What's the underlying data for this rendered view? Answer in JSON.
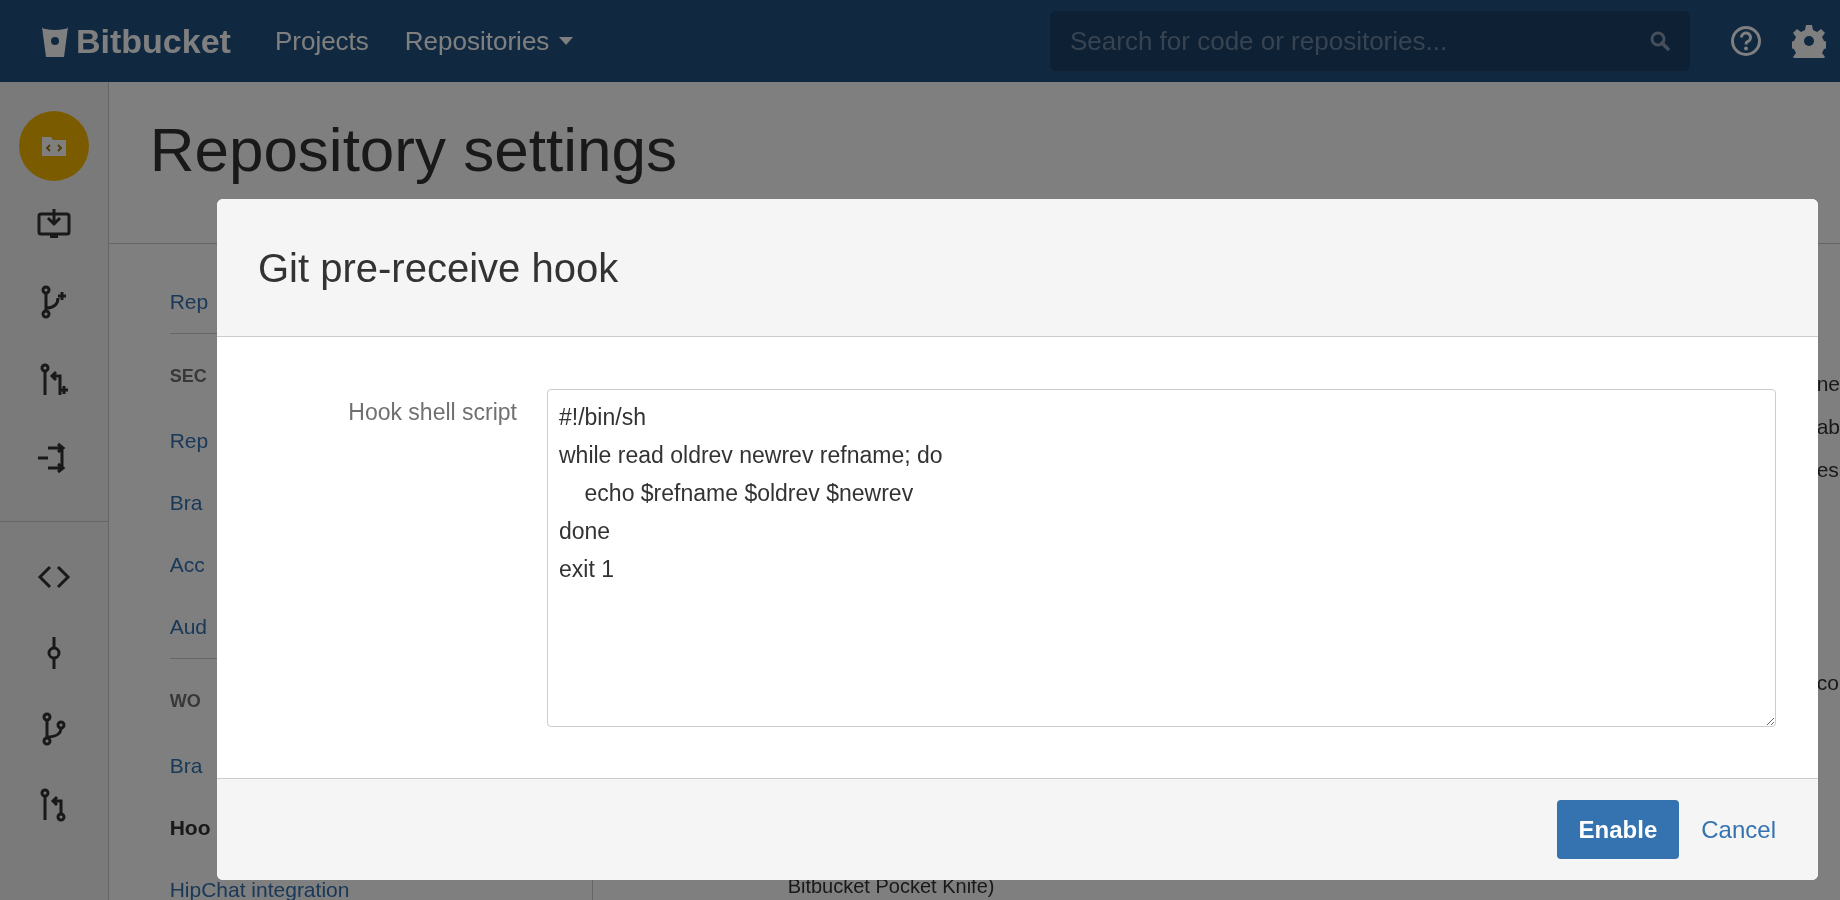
{
  "header": {
    "logo": "Bitbucket",
    "nav": [
      {
        "label": "Projects",
        "dropdown": false
      },
      {
        "label": "Repositories",
        "dropdown": true
      }
    ],
    "search": {
      "placeholder": "Search for code or repositories..."
    }
  },
  "rail": {
    "groups": [
      [
        {
          "kind": "repo",
          "selected": true
        },
        {
          "kind": "clone",
          "selected": false
        },
        {
          "kind": "branch-add",
          "selected": false
        },
        {
          "kind": "pr-add",
          "selected": false
        },
        {
          "kind": "fork",
          "selected": false
        }
      ],
      [
        {
          "kind": "source",
          "selected": false
        },
        {
          "kind": "commit",
          "selected": false
        },
        {
          "kind": "branches",
          "selected": false
        },
        {
          "kind": "pulls",
          "selected": false
        }
      ]
    ]
  },
  "page": {
    "title": "Repository settings",
    "nav_groups": [
      {
        "items": [
          {
            "label": "Rep",
            "selected": false
          }
        ]
      },
      {
        "heading": "SEC",
        "items": [
          {
            "label": "Rep",
            "selected": false
          },
          {
            "label": "Bra",
            "selected": false
          },
          {
            "label": "Acc",
            "selected": false
          },
          {
            "label": "Aud",
            "selected": false
          }
        ]
      },
      {
        "heading": "WO",
        "items": [
          {
            "label": "Bra",
            "selected": false
          },
          {
            "label": "Hoo",
            "selected": true
          },
          {
            "label": "HipChat integration",
            "selected": false
          }
        ]
      }
    ],
    "right_fragments": [
      "ne",
      "ab",
      "es",
      "co"
    ],
    "bottom_fragment": "Bitbucket Pocket Knife)"
  },
  "dialog": {
    "title": "Git pre-receive hook",
    "field_label": "Hook shell script",
    "script": "#!/bin/sh\nwhile read oldrev newrev refname; do\n    echo $refname $oldrev $newrev\ndone\nexit 1",
    "buttons": [
      {
        "label": "Enable",
        "kind": "primary"
      },
      {
        "label": "Cancel",
        "kind": "link"
      }
    ]
  }
}
